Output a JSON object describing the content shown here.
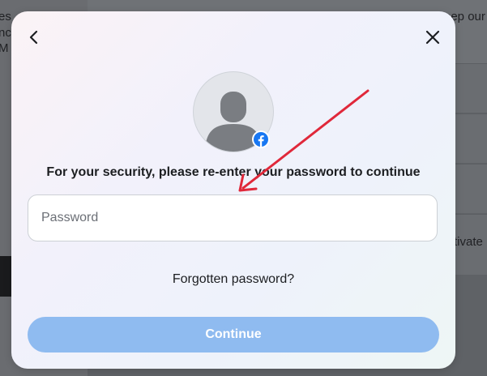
{
  "background": {
    "left_text_lines": [
      "es",
      "nc",
      "M"
    ],
    "right_top_text": "eep our",
    "right_row_text": "tivate"
  },
  "modal": {
    "back_icon": "chevron-left-icon",
    "close_icon": "close-icon",
    "avatar_icon": "default-profile-avatar",
    "badge_icon": "facebook-logo-icon",
    "prompt": "For your security, please re-enter your password to continue",
    "password": {
      "placeholder": "Password",
      "value": ""
    },
    "forgot_label": "Forgotten password?",
    "continue_label": "Continue"
  },
  "colors": {
    "accent_disabled": "#8fbbf0",
    "facebook_blue": "#1877f2",
    "annotation_arrow": "#e0283a",
    "text": "#1c1e21"
  },
  "annotation": {
    "type": "arrow",
    "points_to": "password-input"
  }
}
